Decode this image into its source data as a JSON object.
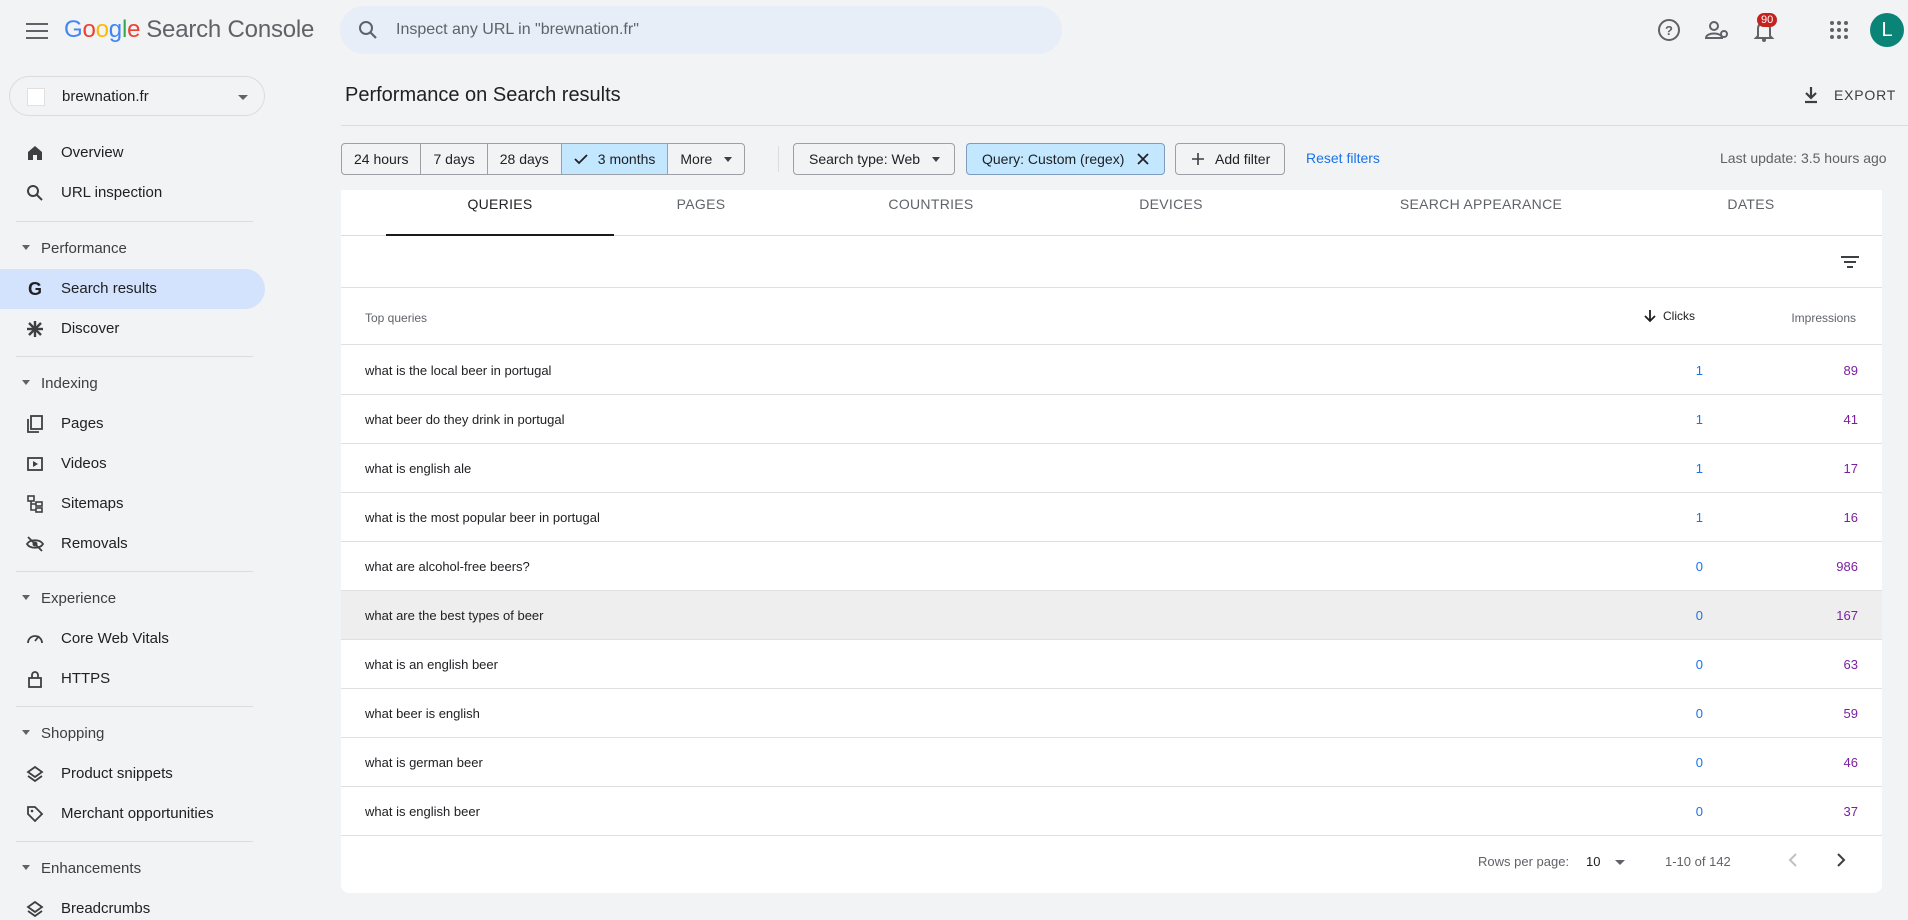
{
  "app": {
    "title_parts": [
      "G",
      "o",
      "o",
      "g",
      "l",
      "e"
    ],
    "title_suffix": "Search Console",
    "search_placeholder": "Inspect any URL in \"brewnation.fr\"",
    "notification_count": "90",
    "avatar_letter": "L"
  },
  "sidebar": {
    "property": "brewnation.fr",
    "items": [
      {
        "label": "Overview"
      },
      {
        "label": "URL inspection"
      }
    ],
    "sections": [
      {
        "label": "Performance",
        "items": [
          {
            "label": "Search results"
          },
          {
            "label": "Discover"
          }
        ]
      },
      {
        "label": "Indexing",
        "items": [
          {
            "label": "Pages"
          },
          {
            "label": "Videos"
          },
          {
            "label": "Sitemaps"
          },
          {
            "label": "Removals"
          }
        ]
      },
      {
        "label": "Experience",
        "items": [
          {
            "label": "Core Web Vitals"
          },
          {
            "label": "HTTPS"
          }
        ]
      },
      {
        "label": "Shopping",
        "items": [
          {
            "label": "Product snippets"
          },
          {
            "label": "Merchant opportunities"
          }
        ]
      },
      {
        "label": "Enhancements",
        "items": [
          {
            "label": "Breadcrumbs"
          }
        ]
      }
    ]
  },
  "main": {
    "title": "Performance on Search results",
    "export_label": "EXPORT",
    "ranges": [
      "24 hours",
      "7 days",
      "28 days",
      "3 months",
      "More"
    ],
    "selected_range": "3 months",
    "search_type_chip": "Search type: Web",
    "query_chip": "Query: Custom (regex)",
    "add_filter": "Add filter",
    "reset_filters": "Reset filters",
    "last_update": "Last update: 3.5 hours ago",
    "tabs": [
      "QUERIES",
      "PAGES",
      "COUNTRIES",
      "DEVICES",
      "SEARCH APPEARANCE",
      "DATES"
    ],
    "active_tab": "QUERIES",
    "table": {
      "col_query": "Top queries",
      "col_clicks": "Clicks",
      "col_impressions": "Impressions",
      "rows": [
        {
          "query": "what is the local beer in portugal",
          "clicks": "1",
          "impressions": "89"
        },
        {
          "query": "what beer do they drink in portugal",
          "clicks": "1",
          "impressions": "41"
        },
        {
          "query": "what is english ale",
          "clicks": "1",
          "impressions": "17"
        },
        {
          "query": "what is the most popular beer in portugal",
          "clicks": "1",
          "impressions": "16"
        },
        {
          "query": "what are alcohol-free beers?",
          "clicks": "0",
          "impressions": "986"
        },
        {
          "query": "what are the best types of beer",
          "clicks": "0",
          "impressions": "167"
        },
        {
          "query": "what is an english beer",
          "clicks": "0",
          "impressions": "63"
        },
        {
          "query": "what beer is english",
          "clicks": "0",
          "impressions": "59"
        },
        {
          "query": "what is german beer",
          "clicks": "0",
          "impressions": "46"
        },
        {
          "query": "what is english beer",
          "clicks": "0",
          "impressions": "37"
        }
      ]
    },
    "pager": {
      "rows_per_page_label": "Rows per page:",
      "rows_per_page": "10",
      "range": "1-10 of 142"
    }
  },
  "colors": {
    "accent": "#1a73e8",
    "impressions": "#7b1fa2",
    "active_nav": "#d3e3fd",
    "chip_selected": "#c2e7ff"
  }
}
